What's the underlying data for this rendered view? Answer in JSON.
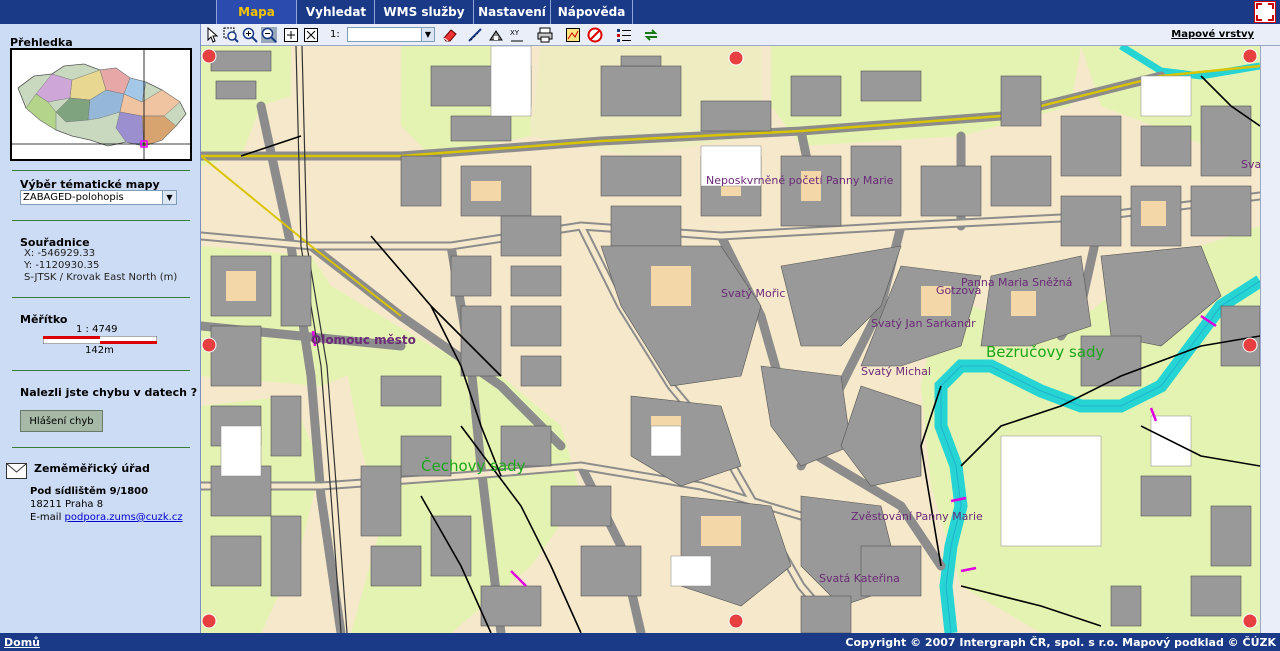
{
  "tabs": [
    "Mapa",
    "Vyhledat",
    "WMS služby",
    "Nastavení",
    "Nápověda"
  ],
  "active_tab": "Mapa",
  "sidebar": {
    "overview_title": "Přehledka",
    "theme_title": "Výběr tématické mapy",
    "theme_selected": "ZABAGED-polohopis",
    "coords_title": "Souřadnice",
    "coord_x": "X:  -546929.33",
    "coord_y": "Y:  -1120930.35",
    "coord_system": "S-JTSK / Krovak East North (m)",
    "scale_title": "Měřítko",
    "scale_ratio": "1 : 4749",
    "scale_length": "142m",
    "error_question": "Nalezli jste chybu v datech ?",
    "error_button": "Hlášení chyb",
    "office_title": "Zeměměřický úřad",
    "address_street": "Pod sídlištěm 9/1800",
    "address_city": "18211 Praha 8",
    "email_label": "E-mail",
    "email": "podpora.zums@cuzk.cz"
  },
  "toolbar": {
    "scale_prefix": "1:",
    "scale_value": "",
    "layers_link": "Mapové vrstvy",
    "icons": [
      "pointer-icon",
      "zoom-box-icon",
      "zoom-in-icon",
      "zoom-out-icon",
      "zoom-full-icon",
      "zoom-previous-icon",
      "eraser-icon",
      "measure-icon",
      "info-icon",
      "xy-icon",
      "print-icon",
      "legend-map-icon",
      "stop-icon",
      "list-icon",
      "refresh-icon"
    ]
  },
  "map": {
    "labels": {
      "olomouc": "Olomouc město",
      "bezrucovy": "Bezručovy sady",
      "cechovy": "Čechovy sady",
      "neposkvrnene": "Neposkvrněné početí Panny Marie",
      "moric": "Svatý Mořic",
      "panna_marie_snezna": "Panna Maria Sněžná",
      "sarkandr": "Svatý Jan Sarkandr",
      "michal": "Svatý Michal",
      "zvestovani": "Zvěstování Panny Marie",
      "katerina": "Svatá Kateřina",
      "gotzova": "Gotzova",
      "sva": "Sva"
    },
    "colors": {
      "background": "#f6e9cb",
      "green": "#e4f3b1",
      "building": "#999999",
      "road": "#8c8c8c",
      "river": "#26d4d4",
      "label_church": "#6b2a77",
      "label_park": "#1aa51a"
    }
  },
  "footer": {
    "home_link": "Domů",
    "copyright": "Copyright © 2007 Intergraph ČR, spol. s r.o.    Mapový podklad © ČÚZK"
  }
}
